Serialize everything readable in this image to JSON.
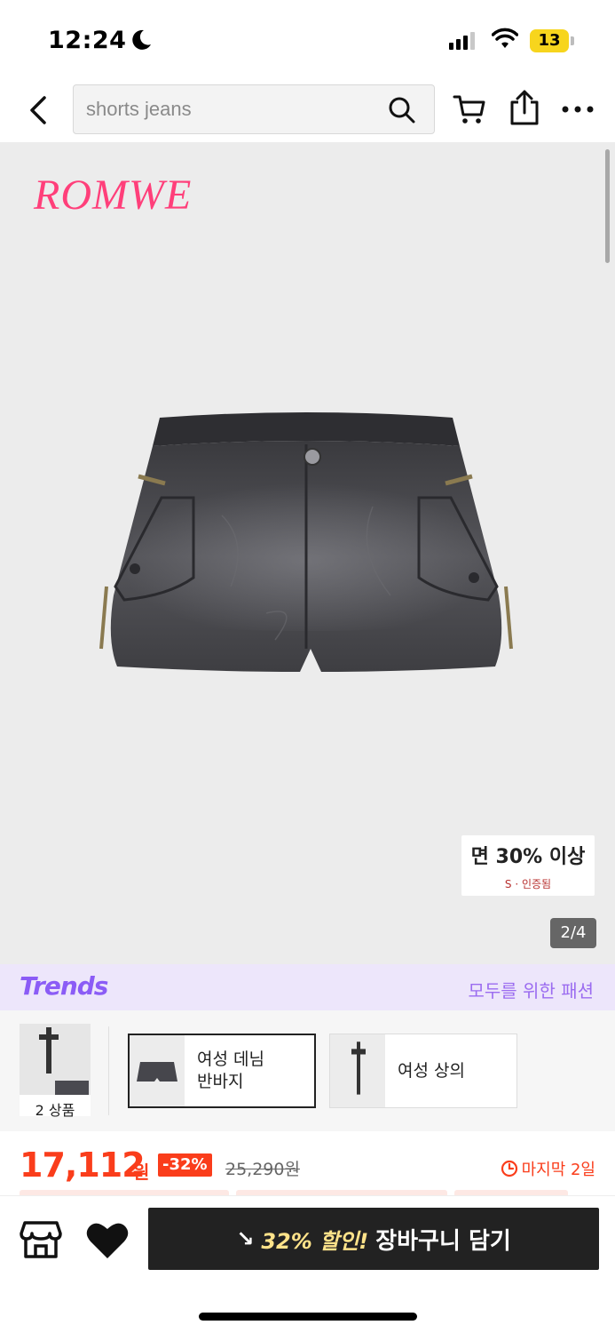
{
  "status_bar": {
    "time": "12:24",
    "battery": "13",
    "icons": [
      "moon-icon",
      "signal-icon",
      "wifi-icon",
      "battery-icon"
    ]
  },
  "header": {
    "search_text": "shorts jeans",
    "icons": [
      "back-icon",
      "search-icon",
      "cart-icon",
      "share-icon",
      "more-icon"
    ]
  },
  "gallery": {
    "brand": "ROMWE",
    "badge_main": "면 30% 이상",
    "badge_sub": "S · 인증됨",
    "counter": "2/4"
  },
  "trends": {
    "logo": "Trends",
    "tagline": "모두를 위한 패션"
  },
  "variants": {
    "bundle_label": "2 상품",
    "items": [
      {
        "label": "여성 데님\n반바지",
        "selected": true
      },
      {
        "label": "여성 상의",
        "selected": false
      }
    ]
  },
  "price": {
    "current": "17,112",
    "unit": "원",
    "discount": "-32%",
    "original": "25,290원",
    "countdown": "마지막 2일"
  },
  "bottom_bar": {
    "promo": "32% 할인!",
    "cta": "장바구니 담기"
  },
  "colors": {
    "brand_pink": "#ff3f7a",
    "price_red": "#fa3d1b",
    "trends_purple": "#8b5cf6",
    "button_dark": "#222222"
  }
}
